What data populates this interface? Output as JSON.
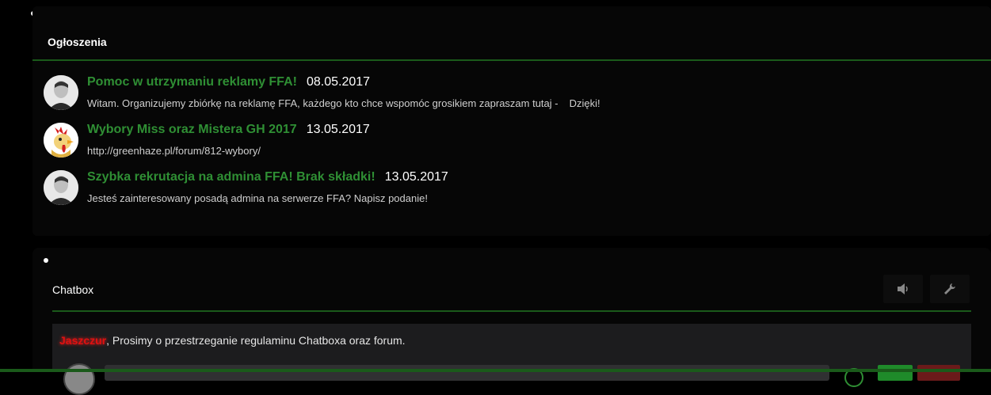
{
  "announcements": {
    "title": "Ogłoszenia",
    "items": [
      {
        "title": "Pomoc w utrzymaniu reklamy FFA!",
        "date": "08.05.2017",
        "text_before": "Witam. Organizujemy zbiórkę na reklamę FFA, każdego kto chce wspomóc grosikiem zapraszam tutaj -",
        "text_after": "Dzięki!",
        "avatar": "user-avatar-photo"
      },
      {
        "title": "Wybory Miss oraz Mistera GH 2017",
        "date": "13.05.2017",
        "text_before": "http://greenhaze.pl/forum/812-wybory/",
        "text_after": "",
        "avatar": "rooster-avatar"
      },
      {
        "title": "Szybka rekrutacja na admina FFA! Brak składki!",
        "date": "13.05.2017",
        "text_before": "Jesteś zainteresowany posadą admina na serwerze FFA? Napisz podanie!",
        "text_after": "",
        "avatar": "user-avatar-photo"
      }
    ]
  },
  "chatbox": {
    "title": "Chatbox",
    "sound_icon": "speaker-icon",
    "settings_icon": "wrench-icon",
    "message": {
      "user": "Jaszczur",
      "text": ", Prosimy o przestrzeganie regulaminu Chatboxa oraz forum."
    }
  },
  "colors": {
    "accent_green": "#2f8f34",
    "username_red": "#e01010",
    "background": "#000000"
  }
}
